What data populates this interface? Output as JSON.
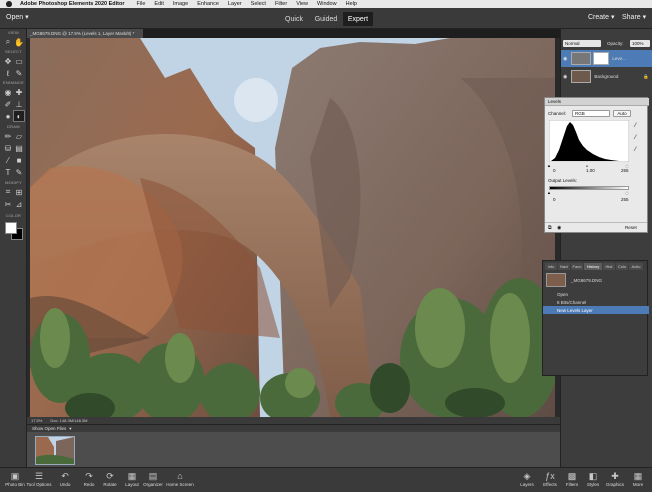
{
  "menubar": {
    "app_name": "Adobe Photoshop Elements 2020 Editor",
    "items": [
      "File",
      "Edit",
      "Image",
      "Enhance",
      "Layer",
      "Select",
      "Filter",
      "View",
      "Window",
      "Help"
    ]
  },
  "appbar": {
    "open_label": "Open",
    "modes": [
      "Quick",
      "Guided",
      "Expert"
    ],
    "active_mode": "Expert",
    "create_label": "Create",
    "share_label": "Share"
  },
  "toolbox": {
    "sections": [
      "VIEW",
      "SELECT",
      "ENHANCE",
      "DRAW",
      "MODIFY",
      "COLOR"
    ]
  },
  "document": {
    "tab_title": "_MG8679.DNG @ 17.5% (Levels 1, Layer Mask/8) *",
    "zoom": "17.5%",
    "doc_size": "Doc: 148.3M/148.3M"
  },
  "show_open_files": "Show Open Files",
  "layers_panel": {
    "blend_mode": "Normal",
    "opacity_label": "Opacity:",
    "opacity_value": "100%",
    "layers": [
      {
        "name": "Leve...",
        "selected": true
      },
      {
        "name": "Background",
        "selected": false
      }
    ]
  },
  "levels_dialog": {
    "title": "Levels",
    "channel_label": "Channel:",
    "channel_value": "RGB",
    "auto_label": "Auto",
    "input_values": [
      "0",
      "1.00",
      "255"
    ],
    "output_label": "Output Levels:",
    "output_values": [
      "0",
      "255"
    ],
    "reset_label": "Reset"
  },
  "history_panel": {
    "tabs": [
      "Info",
      "Navi",
      "Favo",
      "History",
      "Hist",
      "Colo",
      "Actio"
    ],
    "active_tab": "History",
    "snapshot_name": "_MG8679.DNG",
    "steps": [
      {
        "label": "Open",
        "selected": false
      },
      {
        "label": "8 Bits/Channel",
        "selected": false
      },
      {
        "label": "New Levels Layer",
        "selected": true
      }
    ]
  },
  "bottombar": {
    "left_buttons": [
      "Photo Bin",
      "Tool Options",
      "Undo",
      "Redo",
      "Rotate",
      "Layout",
      "Organizer",
      "Home Screen"
    ],
    "left_icons": [
      "photo-bin-icon",
      "tool-options-icon",
      "undo-icon",
      "redo-icon",
      "rotate-icon",
      "layout-icon",
      "organizer-icon",
      "home-icon"
    ],
    "right_buttons": [
      "Layers",
      "Effects",
      "Filters",
      "Styles",
      "Graphics",
      "More"
    ],
    "right_icons": [
      "layers-icon",
      "effects-icon",
      "filters-icon",
      "styles-icon",
      "graphics-icon",
      "more-icon"
    ]
  }
}
